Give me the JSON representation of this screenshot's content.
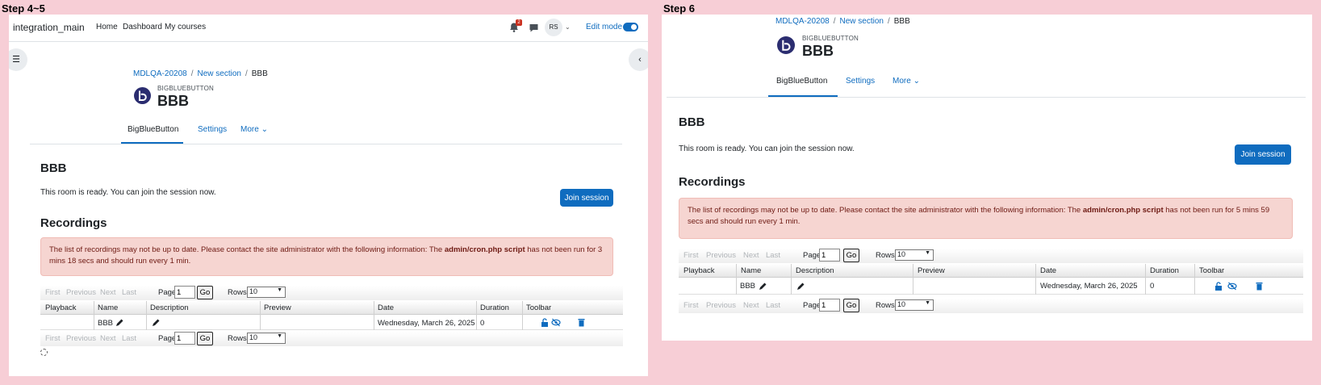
{
  "steps": {
    "left": "Step 4~5",
    "right": "Step 6"
  },
  "navbar": {
    "brand": "integration_main",
    "links": [
      "Home",
      "Dashboard",
      "My courses"
    ],
    "notification_count": "2",
    "avatar_initials": "RS",
    "edit_mode_label": "Edit mode"
  },
  "breadcrumb": {
    "course": "MDLQA-20208",
    "section": "New section",
    "activity": "BBB"
  },
  "module": {
    "type": "BIGBLUEBUTTON",
    "title": "BBB"
  },
  "tabs": [
    "BigBlueButton",
    "Settings",
    "More"
  ],
  "room": {
    "title": "BBB",
    "message": "This room is ready. You can join the session now.",
    "join_label": "Join session"
  },
  "recordings": {
    "title": "Recordings",
    "alert_prefix": "The list of recordings may not be up to date. Please contact the site administrator with the following information: The ",
    "alert_bold": "admin/cron.php script",
    "alert_suffix_left": " has not been run for 3 mins 18 secs and should run every 1 min.",
    "alert_suffix_right": " has not been run for 5 mins 59 secs and should run every 1 min.",
    "pager": {
      "first": "First",
      "previous": "Previous",
      "next": "Next",
      "last": "Last",
      "page_label": "Page",
      "page_value": "1",
      "go": "Go",
      "rows_label": "Rows",
      "rows_value": "10"
    },
    "columns": [
      "Playback",
      "Name",
      "Description",
      "Preview",
      "Date",
      "Duration",
      "Toolbar"
    ],
    "rows": [
      {
        "playback": "",
        "name": "BBB",
        "description": "",
        "preview": "",
        "date": "Wednesday, March 26, 2025",
        "duration": "0"
      }
    ]
  },
  "colors": {
    "primary": "#0f6cbf",
    "alert_bg": "#f6d5d1",
    "background": "#f7ced6"
  }
}
